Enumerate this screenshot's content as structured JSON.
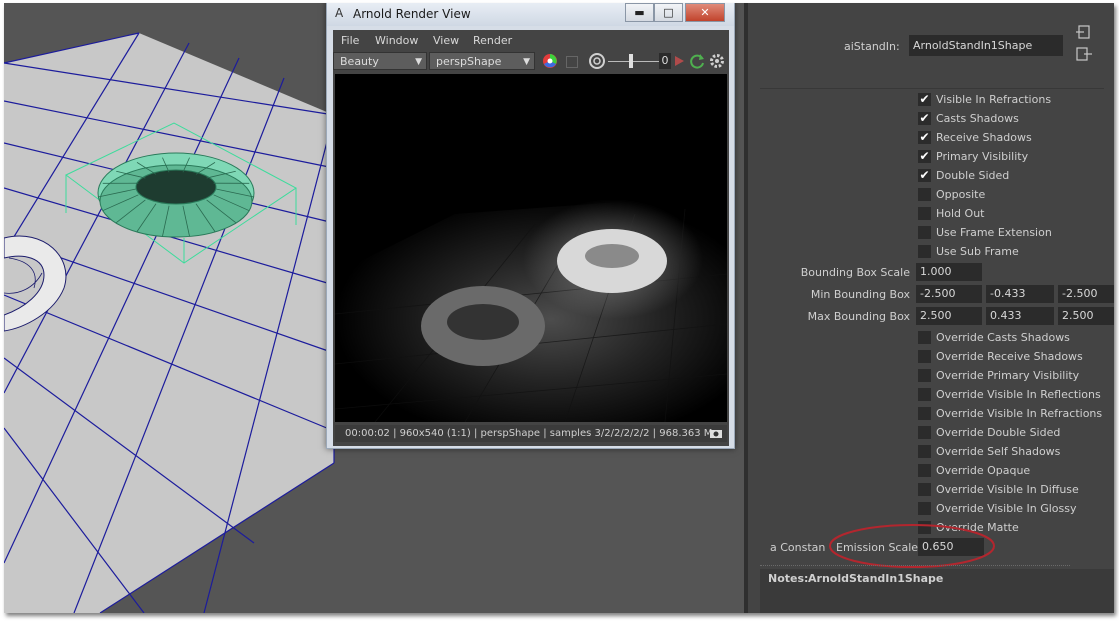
{
  "render_window": {
    "title": "Arnold Render View",
    "logo_glyph": "A",
    "minimize": "▬",
    "maximize": "□",
    "close": "✕",
    "menu": [
      "File",
      "Window",
      "View",
      "Render"
    ],
    "aov_value": "Beauty",
    "camera_value": "perspShape",
    "exposure_value": "0",
    "status_text": "00:00:02 | 960x540 (1:1) | perspShape  | samples 3/2/2/2/2/2 | 968.363 M"
  },
  "attribute_editor": {
    "node_label": "aiStandIn:",
    "node_value": "ArnoldStandIn1Shape",
    "top_checkboxes": [
      {
        "label": "Visible In Refractions",
        "checked": true
      },
      {
        "label": "Casts Shadows",
        "checked": true
      },
      {
        "label": "Receive Shadows",
        "checked": true
      },
      {
        "label": "Primary Visibility",
        "checked": true
      },
      {
        "label": "Double Sided",
        "checked": true
      },
      {
        "label": "Opposite",
        "checked": false
      },
      {
        "label": "Hold Out",
        "checked": false
      },
      {
        "label": "Use Frame Extension",
        "checked": false
      },
      {
        "label": "Use Sub Frame",
        "checked": false
      }
    ],
    "bounding_box_scale": {
      "label": "Bounding Box Scale",
      "value": "1.000"
    },
    "min_bounding_box": {
      "label": "Min Bounding Box",
      "values": [
        "-2.500",
        "-0.433",
        "-2.500"
      ]
    },
    "max_bounding_box": {
      "label": "Max Bounding Box",
      "values": [
        "2.500",
        "0.433",
        "2.500"
      ]
    },
    "override_checkboxes": [
      {
        "label": "Override Casts Shadows",
        "checked": false
      },
      {
        "label": "Override Receive Shadows",
        "checked": false
      },
      {
        "label": "Override Primary Visibility",
        "checked": false
      },
      {
        "label": "Override Visible In Reflections",
        "checked": false
      },
      {
        "label": "Override Visible In Refractions",
        "checked": false
      },
      {
        "label": "Override Double Sided",
        "checked": false
      },
      {
        "label": "Override Self Shadows",
        "checked": false
      },
      {
        "label": "Override Opaque",
        "checked": false
      },
      {
        "label": "Override Visible In Diffuse",
        "checked": false
      },
      {
        "label": "Override Visible In Glossy",
        "checked": false
      },
      {
        "label": "Override Matte",
        "checked": false
      }
    ],
    "emission_partial_label": "a Constan",
    "emission_label": "Emission Scale",
    "emission_value": "0.650",
    "notes_label": "Notes:",
    "notes_value": "ArnoldStandIn1Shape"
  },
  "colors": {
    "annotation_ellipse": "#b3262e",
    "selection_wire": "#3ddc9c",
    "grid_line": "#1c1c9c"
  }
}
